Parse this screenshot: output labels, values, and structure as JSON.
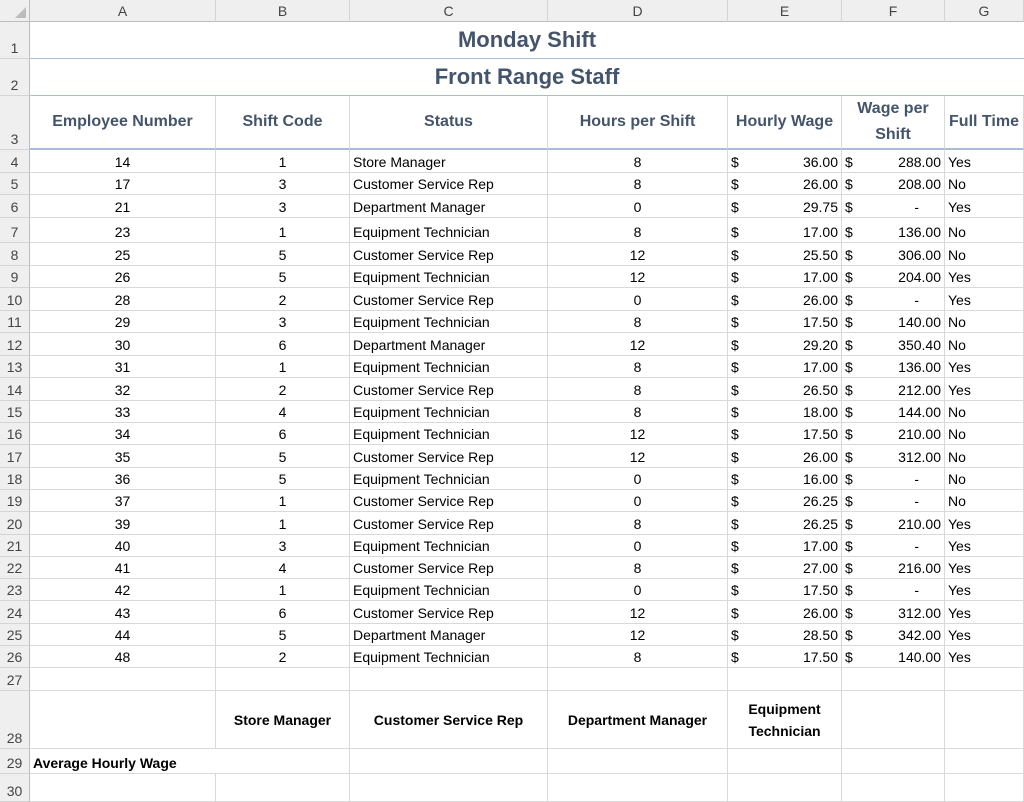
{
  "columns": [
    "A",
    "B",
    "C",
    "D",
    "E",
    "F",
    "G"
  ],
  "row_numbers": [
    "1",
    "2",
    "3",
    "4",
    "5",
    "6",
    "7",
    "8",
    "9",
    "10",
    "11",
    "12",
    "13",
    "14",
    "15",
    "16",
    "17",
    "18",
    "19",
    "20",
    "21",
    "22",
    "23",
    "24",
    "25",
    "26",
    "27",
    "28",
    "29",
    "30"
  ],
  "title": "Monday Shift",
  "subtitle": "Front Range Staff",
  "headers": {
    "employee_number": "Employee Number",
    "shift_code": "Shift Code",
    "status": "Status",
    "hours_per_shift": "Hours per Shift",
    "hourly_wage": "Hourly Wage",
    "wage_per_shift": "Wage per Shift",
    "full_time": "Full Time"
  },
  "currency_symbol": "$",
  "employees": [
    {
      "num": "14",
      "code": "1",
      "status": "Store Manager",
      "hours": "8",
      "wage": "36.00",
      "per_shift": "288.00",
      "full_time": "Yes"
    },
    {
      "num": "17",
      "code": "3",
      "status": "Customer Service Rep",
      "hours": "8",
      "wage": "26.00",
      "per_shift": "208.00",
      "full_time": "No"
    },
    {
      "num": "21",
      "code": "3",
      "status": "Department Manager",
      "hours": "0",
      "wage": "29.75",
      "per_shift": "-",
      "full_time": "Yes"
    },
    {
      "num": "23",
      "code": "1",
      "status": "Equipment Technician",
      "hours": "8",
      "wage": "17.00",
      "per_shift": "136.00",
      "full_time": "No"
    },
    {
      "num": "25",
      "code": "5",
      "status": "Customer Service Rep",
      "hours": "12",
      "wage": "25.50",
      "per_shift": "306.00",
      "full_time": "No"
    },
    {
      "num": "26",
      "code": "5",
      "status": "Equipment Technician",
      "hours": "12",
      "wage": "17.00",
      "per_shift": "204.00",
      "full_time": "Yes"
    },
    {
      "num": "28",
      "code": "2",
      "status": "Customer Service Rep",
      "hours": "0",
      "wage": "26.00",
      "per_shift": "-",
      "full_time": "Yes"
    },
    {
      "num": "29",
      "code": "3",
      "status": "Equipment Technician",
      "hours": "8",
      "wage": "17.50",
      "per_shift": "140.00",
      "full_time": "No"
    },
    {
      "num": "30",
      "code": "6",
      "status": "Department Manager",
      "hours": "12",
      "wage": "29.20",
      "per_shift": "350.40",
      "full_time": "No"
    },
    {
      "num": "31",
      "code": "1",
      "status": "Equipment Technician",
      "hours": "8",
      "wage": "17.00",
      "per_shift": "136.00",
      "full_time": "Yes"
    },
    {
      "num": "32",
      "code": "2",
      "status": "Customer Service Rep",
      "hours": "8",
      "wage": "26.50",
      "per_shift": "212.00",
      "full_time": "Yes"
    },
    {
      "num": "33",
      "code": "4",
      "status": "Equipment Technician",
      "hours": "8",
      "wage": "18.00",
      "per_shift": "144.00",
      "full_time": "No"
    },
    {
      "num": "34",
      "code": "6",
      "status": "Equipment Technician",
      "hours": "12",
      "wage": "17.50",
      "per_shift": "210.00",
      "full_time": "No"
    },
    {
      "num": "35",
      "code": "5",
      "status": "Customer Service Rep",
      "hours": "12",
      "wage": "26.00",
      "per_shift": "312.00",
      "full_time": "No"
    },
    {
      "num": "36",
      "code": "5",
      "status": "Equipment Technician",
      "hours": "0",
      "wage": "16.00",
      "per_shift": "-",
      "full_time": "No"
    },
    {
      "num": "37",
      "code": "1",
      "status": "Customer Service Rep",
      "hours": "0",
      "wage": "26.25",
      "per_shift": "-",
      "full_time": "No"
    },
    {
      "num": "39",
      "code": "1",
      "status": "Customer Service Rep",
      "hours": "8",
      "wage": "26.25",
      "per_shift": "210.00",
      "full_time": "Yes"
    },
    {
      "num": "40",
      "code": "3",
      "status": "Equipment Technician",
      "hours": "0",
      "wage": "17.00",
      "per_shift": "-",
      "full_time": "Yes"
    },
    {
      "num": "41",
      "code": "4",
      "status": "Customer Service Rep",
      "hours": "8",
      "wage": "27.00",
      "per_shift": "216.00",
      "full_time": "Yes"
    },
    {
      "num": "42",
      "code": "1",
      "status": "Equipment Technician",
      "hours": "0",
      "wage": "17.50",
      "per_shift": "-",
      "full_time": "Yes"
    },
    {
      "num": "43",
      "code": "6",
      "status": "Customer Service Rep",
      "hours": "12",
      "wage": "26.00",
      "per_shift": "312.00",
      "full_time": "Yes"
    },
    {
      "num": "44",
      "code": "5",
      "status": "Department Manager",
      "hours": "12",
      "wage": "28.50",
      "per_shift": "342.00",
      "full_time": "Yes"
    },
    {
      "num": "48",
      "code": "2",
      "status": "Equipment Technician",
      "hours": "8",
      "wage": "17.50",
      "per_shift": "140.00",
      "full_time": "Yes"
    }
  ],
  "summary_headers": [
    "Store Manager",
    "Customer Service Rep",
    "Department Manager",
    "Equipment Technician"
  ],
  "summary_row_label": "Average Hourly Wage"
}
